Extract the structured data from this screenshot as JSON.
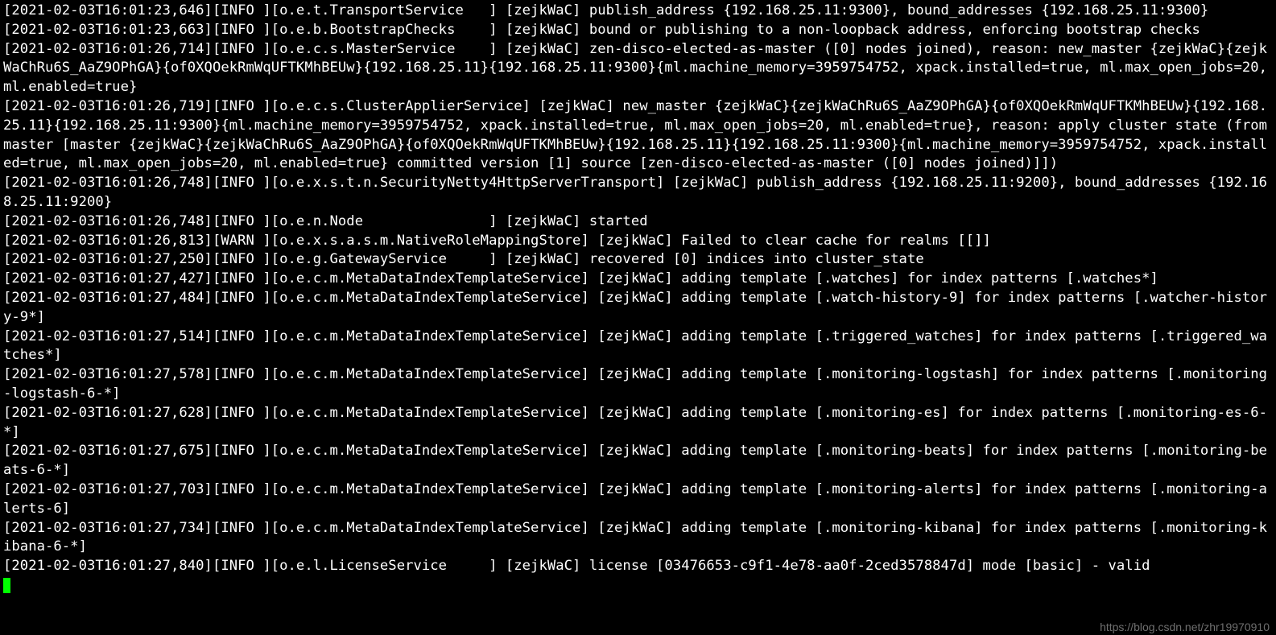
{
  "log_lines": [
    "[2021-02-03T16:01:23,646][INFO ][o.e.t.TransportService   ] [zejkWaC] publish_address {192.168.25.11:9300}, bound_addresses {192.168.25.11:9300}",
    "[2021-02-03T16:01:23,663][INFO ][o.e.b.BootstrapChecks    ] [zejkWaC] bound or publishing to a non-loopback address, enforcing bootstrap checks",
    "[2021-02-03T16:01:26,714][INFO ][o.e.c.s.MasterService    ] [zejkWaC] zen-disco-elected-as-master ([0] nodes joined), reason: new_master {zejkWaC}{zejkWaChRu6S_AaZ9OPhGA}{of0XQOekRmWqUFTKMhBEUw}{192.168.25.11}{192.168.25.11:9300}{ml.machine_memory=3959754752, xpack.installed=true, ml.max_open_jobs=20, ml.enabled=true}",
    "[2021-02-03T16:01:26,719][INFO ][o.e.c.s.ClusterApplierService] [zejkWaC] new_master {zejkWaC}{zejkWaChRu6S_AaZ9OPhGA}{of0XQOekRmWqUFTKMhBEUw}{192.168.25.11}{192.168.25.11:9300}{ml.machine_memory=3959754752, xpack.installed=true, ml.max_open_jobs=20, ml.enabled=true}, reason: apply cluster state (from master [master {zejkWaC}{zejkWaChRu6S_AaZ9OPhGA}{of0XQOekRmWqUFTKMhBEUw}{192.168.25.11}{192.168.25.11:9300}{ml.machine_memory=3959754752, xpack.installed=true, ml.max_open_jobs=20, ml.enabled=true} committed version [1] source [zen-disco-elected-as-master ([0] nodes joined)]])",
    "[2021-02-03T16:01:26,748][INFO ][o.e.x.s.t.n.SecurityNetty4HttpServerTransport] [zejkWaC] publish_address {192.168.25.11:9200}, bound_addresses {192.168.25.11:9200}",
    "[2021-02-03T16:01:26,748][INFO ][o.e.n.Node               ] [zejkWaC] started",
    "[2021-02-03T16:01:26,813][WARN ][o.e.x.s.a.s.m.NativeRoleMappingStore] [zejkWaC] Failed to clear cache for realms [[]]",
    "[2021-02-03T16:01:27,250][INFO ][o.e.g.GatewayService     ] [zejkWaC] recovered [0] indices into cluster_state",
    "[2021-02-03T16:01:27,427][INFO ][o.e.c.m.MetaDataIndexTemplateService] [zejkWaC] adding template [.watches] for index patterns [.watches*]",
    "[2021-02-03T16:01:27,484][INFO ][o.e.c.m.MetaDataIndexTemplateService] [zejkWaC] adding template [.watch-history-9] for index patterns [.watcher-history-9*]",
    "[2021-02-03T16:01:27,514][INFO ][o.e.c.m.MetaDataIndexTemplateService] [zejkWaC] adding template [.triggered_watches] for index patterns [.triggered_watches*]",
    "[2021-02-03T16:01:27,578][INFO ][o.e.c.m.MetaDataIndexTemplateService] [zejkWaC] adding template [.monitoring-logstash] for index patterns [.monitoring-logstash-6-*]",
    "[2021-02-03T16:01:27,628][INFO ][o.e.c.m.MetaDataIndexTemplateService] [zejkWaC] adding template [.monitoring-es] for index patterns [.monitoring-es-6-*]",
    "[2021-02-03T16:01:27,675][INFO ][o.e.c.m.MetaDataIndexTemplateService] [zejkWaC] adding template [.monitoring-beats] for index patterns [.monitoring-beats-6-*]",
    "[2021-02-03T16:01:27,703][INFO ][o.e.c.m.MetaDataIndexTemplateService] [zejkWaC] adding template [.monitoring-alerts] for index patterns [.monitoring-alerts-6]",
    "[2021-02-03T16:01:27,734][INFO ][o.e.c.m.MetaDataIndexTemplateService] [zejkWaC] adding template [.monitoring-kibana] for index patterns [.monitoring-kibana-6-*]",
    "[2021-02-03T16:01:27,840][INFO ][o.e.l.LicenseService     ] [zejkWaC] license [03476653-c9f1-4e78-aa0f-2ced3578847d] mode [basic] - valid"
  ],
  "watermark": "https://blog.csdn.net/zhr19970910"
}
